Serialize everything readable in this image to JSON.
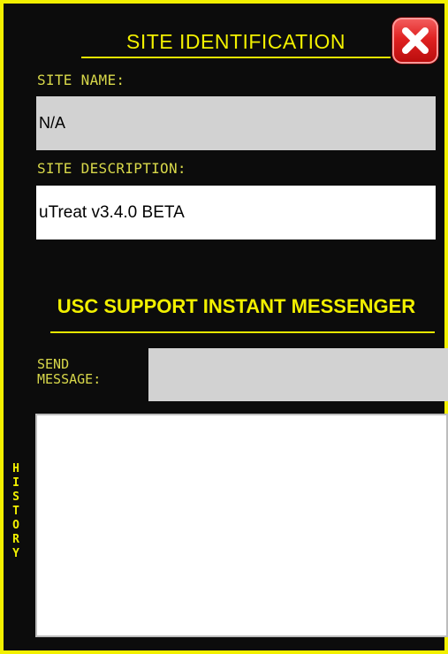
{
  "dialog": {
    "title": "SITE IDENTIFICATION",
    "close_icon": "close-x-icon",
    "accent_color": "#f2f000",
    "close_color": "#e02222"
  },
  "site_name": {
    "label": "SITE NAME:",
    "value": "N/A"
  },
  "site_description": {
    "label": "SITE DESCRIPTION:",
    "value": "uTreat v3.4.0 BETA"
  },
  "messenger": {
    "title": "USC SUPPORT INSTANT MESSENGER",
    "send_label_line1": "SEND",
    "send_label_line2": "MESSAGE:",
    "send_value": "",
    "history_label": "HISTORY",
    "history_text": ""
  }
}
